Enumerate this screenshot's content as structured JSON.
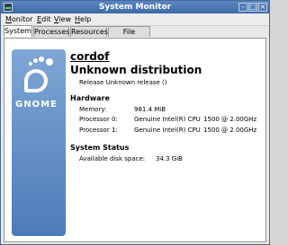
{
  "window": {
    "title": "System Monitor"
  },
  "menubar": {
    "items": [
      {
        "label": "Monitor",
        "mnemonic": "M",
        "rest": "onitor"
      },
      {
        "label": "Edit",
        "mnemonic": "E",
        "rest": "dit"
      },
      {
        "label": "View",
        "mnemonic": "V",
        "rest": "iew"
      },
      {
        "label": "Help",
        "mnemonic": "H",
        "rest": "elp"
      }
    ]
  },
  "tabs": [
    {
      "label": "System",
      "active": true
    },
    {
      "label": "Processes",
      "active": false
    },
    {
      "label": "Resources",
      "active": false
    },
    {
      "label": "File Systems",
      "active": false
    }
  ],
  "logo": {
    "text": "GNOME",
    "icon": "gnome-foot-icon"
  },
  "system": {
    "hostname": "cordof",
    "distribution": "Unknown distribution",
    "release": "Release Unknown release ()",
    "hardware_title": "Hardware",
    "memory_label": "Memory:",
    "memory_value": "981.4 MiB",
    "processors": [
      {
        "label": "Processor 0:",
        "model": "Genuine Intel(R) CPU",
        "speed": "1500  @ 2.00GHz"
      },
      {
        "label": "Processor 1:",
        "model": "Genuine Intel(R) CPU",
        "speed": "1500  @ 2.00GHz"
      }
    ],
    "status_title": "System Status",
    "disk_label": "Available disk space:",
    "disk_value": "34.3 GiB"
  }
}
